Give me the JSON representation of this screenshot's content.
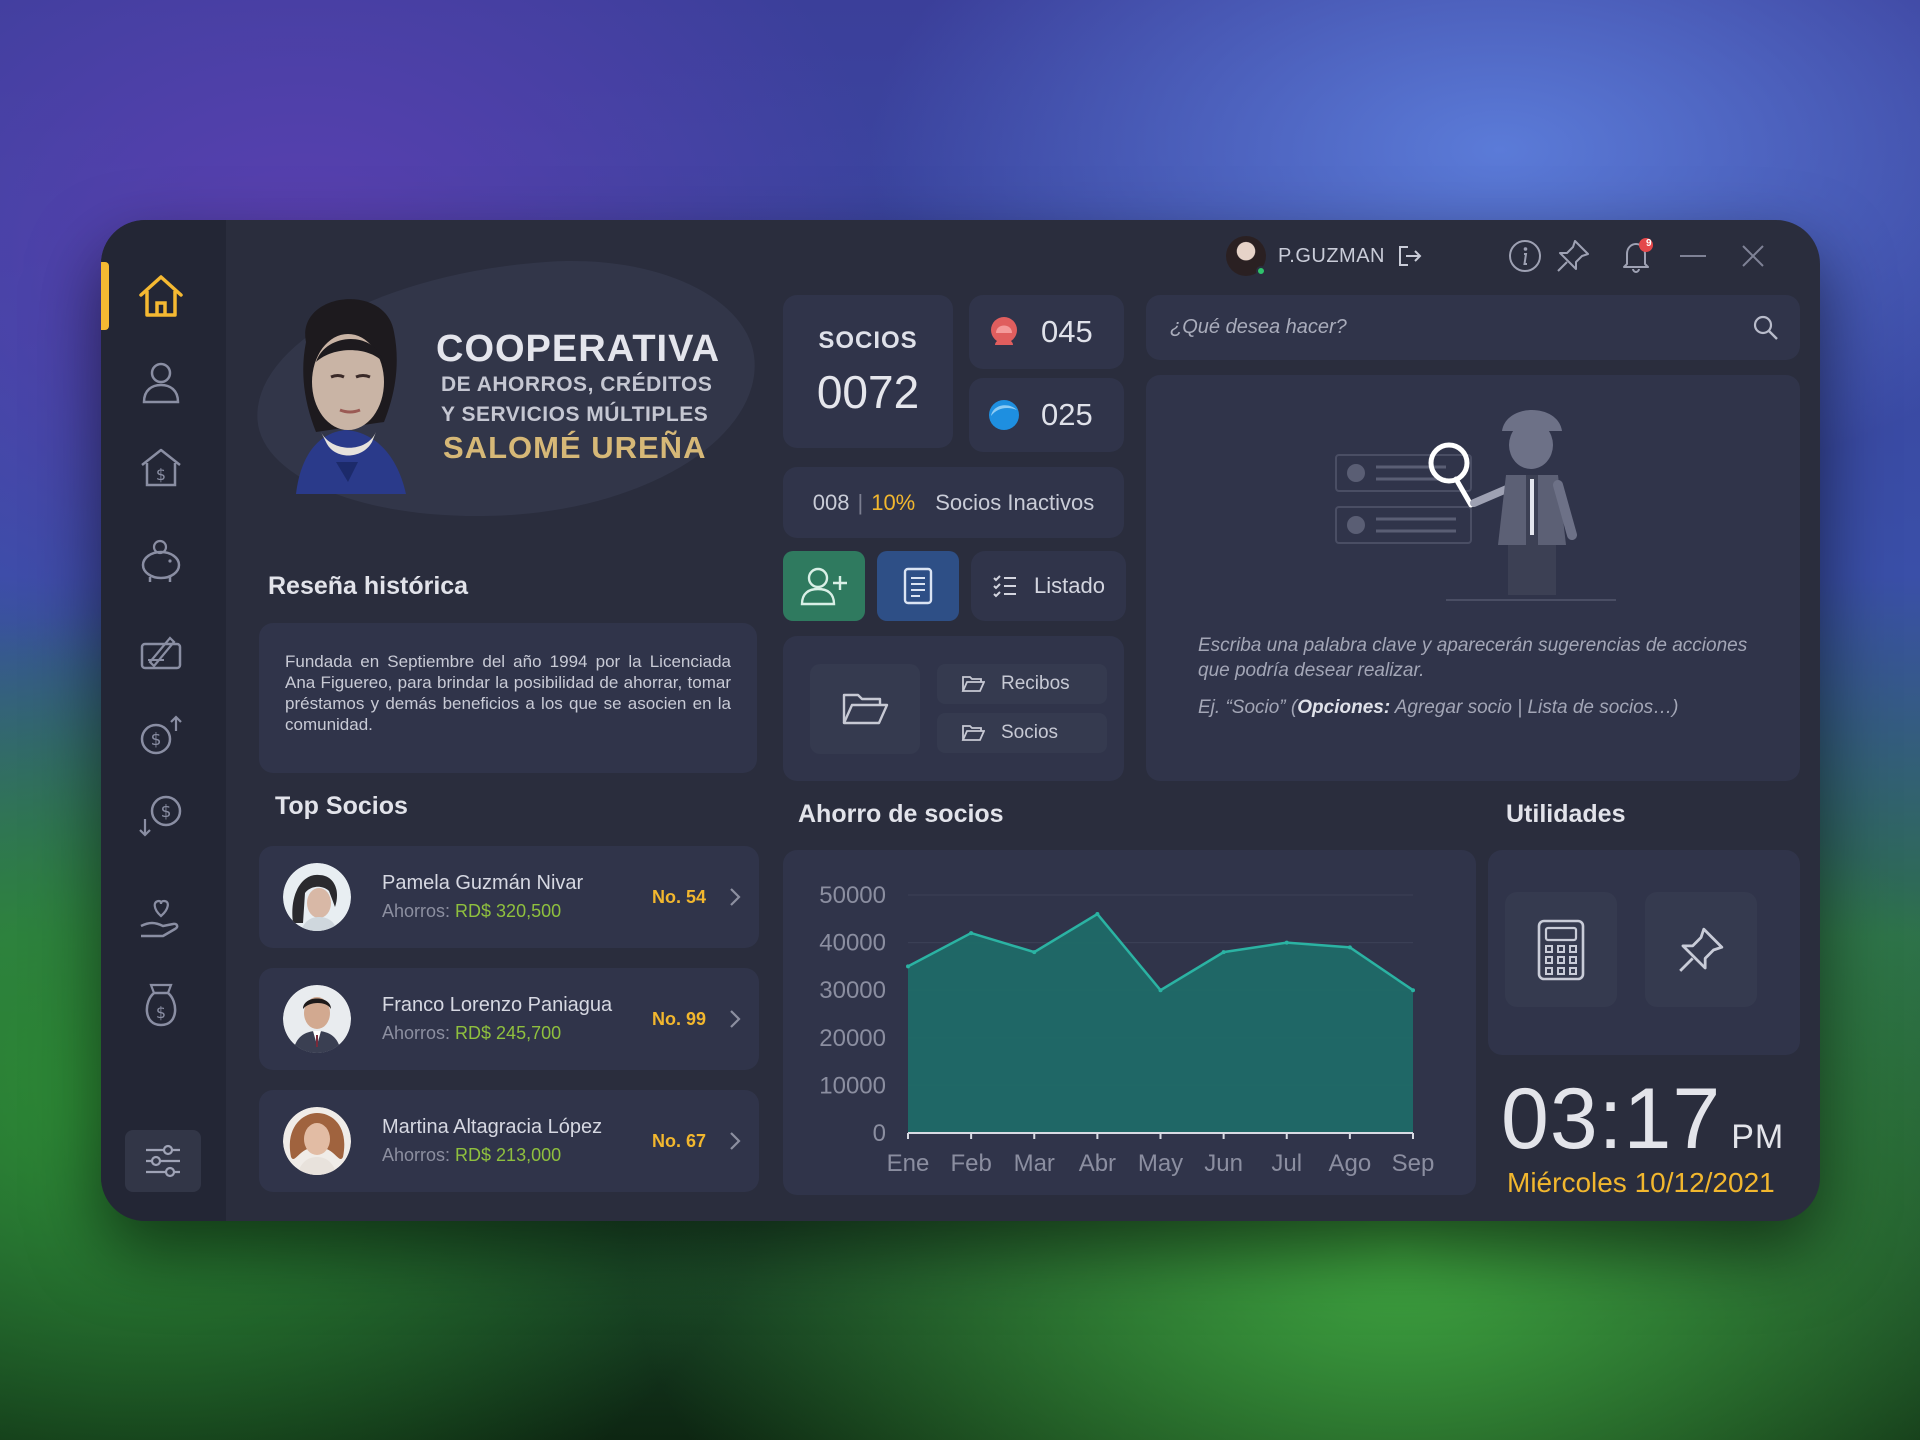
{
  "header": {
    "user_name": "P.GUZMAN",
    "notification_count": "9"
  },
  "brand": {
    "line1": "COOPERATIVA",
    "line2": "DE AHORROS, CRÉDITOS",
    "line3": "Y SERVICIOS  MÚLTIPLES",
    "line4": "SALOMÉ UREÑA"
  },
  "history": {
    "title": "Reseña histórica",
    "text": "Fundada en Septiembre del año 1994 por la Licenciada Ana Figuereo, para brindar la posibilidad de ahorrar, tomar préstamos y demás beneficios a los que se asocien en la comunidad."
  },
  "top_socios": {
    "title": "Top Socios",
    "savings_label": "Ahorros: ",
    "items": [
      {
        "name": "Pamela Guzmán Nivar",
        "amount": "RD$ 320,500",
        "number": "No. 54"
      },
      {
        "name": "Franco Lorenzo Paniagua",
        "amount": "RD$ 245,700",
        "number": "No. 99"
      },
      {
        "name": "Martina Altagracia López",
        "amount": "RD$ 213,000",
        "number": "No. 67"
      }
    ]
  },
  "stats": {
    "socios_label": "SOCIOS",
    "socios_total": "0072",
    "female_count": "045",
    "male_count": "025",
    "inactive_count": "008",
    "inactive_sep": "|",
    "inactive_pct": "10%",
    "inactive_label": "Socios Inactivos"
  },
  "actions": {
    "listado_label": "Listado",
    "folders": [
      "Recibos",
      "Socios"
    ]
  },
  "search": {
    "placeholder": "¿Qué desea hacer?"
  },
  "helper": {
    "description": "Escriba una palabra clave y aparecerán sugerencias de acciones que podría desear realizar.",
    "example_prefix": "Ej.  “Socio” (",
    "example_bold": "Opciones:",
    "example_rest": " Agregar socio  |  Lista de socios…)"
  },
  "chart_section_title": "Ahorro de socios",
  "utilities_title": "Utilidades",
  "clock": {
    "time": "03:17",
    "ampm": "PM",
    "date": "Miércoles 10/12/2021"
  },
  "colors": {
    "accent": "#f2b72e",
    "background": "#2a2d3d",
    "card": "#30344a",
    "chart_fill": "#1f6a67",
    "chart_line": "#2bb3a3",
    "add_button": "#2f7a5f",
    "doc_button": "#2e4f86"
  },
  "icons": {
    "sidebar": [
      "home-icon",
      "user-icon",
      "bank-icon",
      "piggy-bank-icon",
      "contract-icon",
      "money-up-icon",
      "money-down-icon",
      "charity-hand-icon",
      "money-bag-icon",
      "settings-sliders-icon"
    ],
    "header": [
      "logout-icon",
      "info-icon",
      "pin-icon",
      "bell-icon",
      "minimize-icon",
      "close-icon"
    ]
  },
  "chart_data": {
    "type": "area",
    "categories": [
      "Ene",
      "Feb",
      "Mar",
      "Abr",
      "May",
      "Jun",
      "Jul",
      "Ago",
      "Sep"
    ],
    "values": [
      35000,
      42000,
      38000,
      46000,
      30000,
      38000,
      40000,
      39000,
      30000
    ],
    "ylim": [
      0,
      50000
    ],
    "yticks": [
      0,
      10000,
      20000,
      30000,
      40000,
      50000
    ],
    "grid": true,
    "title": "",
    "xlabel": "",
    "ylabel": ""
  }
}
